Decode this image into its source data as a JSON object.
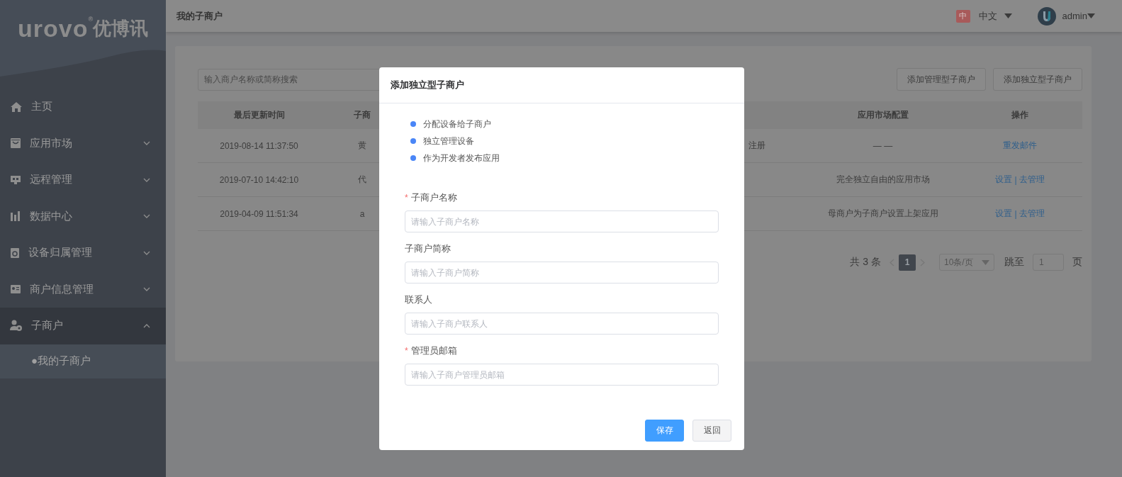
{
  "logo": {
    "brand": "urovo",
    "mark": "®",
    "chinese": "优博讯"
  },
  "header": {
    "title": "我的子商户",
    "language": {
      "flag": "中",
      "label": "中文"
    },
    "user": "admin"
  },
  "sidebar": {
    "items": [
      {
        "label": "主页",
        "kind": "link"
      },
      {
        "label": "应用市场",
        "kind": "group",
        "expanded": false
      },
      {
        "label": "远程管理",
        "kind": "group",
        "expanded": false
      },
      {
        "label": "数据中心",
        "kind": "group",
        "expanded": false
      },
      {
        "label": "设备归属管理",
        "kind": "group",
        "expanded": false
      },
      {
        "label": "商户信息管理",
        "kind": "group",
        "expanded": false
      },
      {
        "label": "子商户",
        "kind": "group",
        "expanded": true,
        "children": [
          {
            "label": "我的子商户",
            "bullet": "●",
            "selected": true
          }
        ]
      }
    ]
  },
  "search": {
    "placeholder": "输入商户名称或简称搜索"
  },
  "toolbar_buttons": [
    "添加管理型子商户",
    "添加独立型子商户"
  ],
  "table": {
    "columns": [
      "最后更新时间",
      "子商",
      "应用市场配置",
      "操作"
    ],
    "rows": [
      {
        "cells": [
          "2019-08-14 11:37:50",
          "黄",
          "— —"
        ],
        "status": "注册",
        "actions": [
          "重发邮件"
        ]
      },
      {
        "cells": [
          "2019-07-10 14:42:10",
          "代",
          "完全独立自由的应用市场"
        ],
        "actions": [
          "设置",
          "去管理"
        ],
        "separator": "|"
      },
      {
        "cells": [
          "2019-04-09 11:51:34",
          "a",
          "母商户为子商户设置上架应用"
        ],
        "actions": [
          "设置",
          "去管理"
        ],
        "separator": "|"
      }
    ]
  },
  "pagination": {
    "total": "共 3 条",
    "pages": [
      {
        "label": "1",
        "selected": true
      }
    ],
    "page_size": "10条/页",
    "jump_label": "跳至",
    "jump_value": "1",
    "jump_suffix": "页"
  },
  "modal": {
    "title": "添加独立型子商户",
    "bullets": [
      "分配设备给子商户",
      "独立管理设备",
      "作为开发者发布应用"
    ],
    "fields": [
      {
        "label": "子商户名称",
        "required_mark": "*",
        "placeholder": "请输入子商户名称"
      },
      {
        "label": "子商户简称",
        "placeholder": "请输入子商户简称"
      },
      {
        "label": "联系人",
        "placeholder": "请输入子商户联系人"
      },
      {
        "label": "管理员邮箱",
        "required_mark": "*",
        "placeholder": "请输入子商户管理员邮箱"
      }
    ],
    "buttons": [
      {
        "label": "保存",
        "kind": "primary"
      },
      {
        "label": "返回",
        "kind": "default"
      }
    ]
  }
}
